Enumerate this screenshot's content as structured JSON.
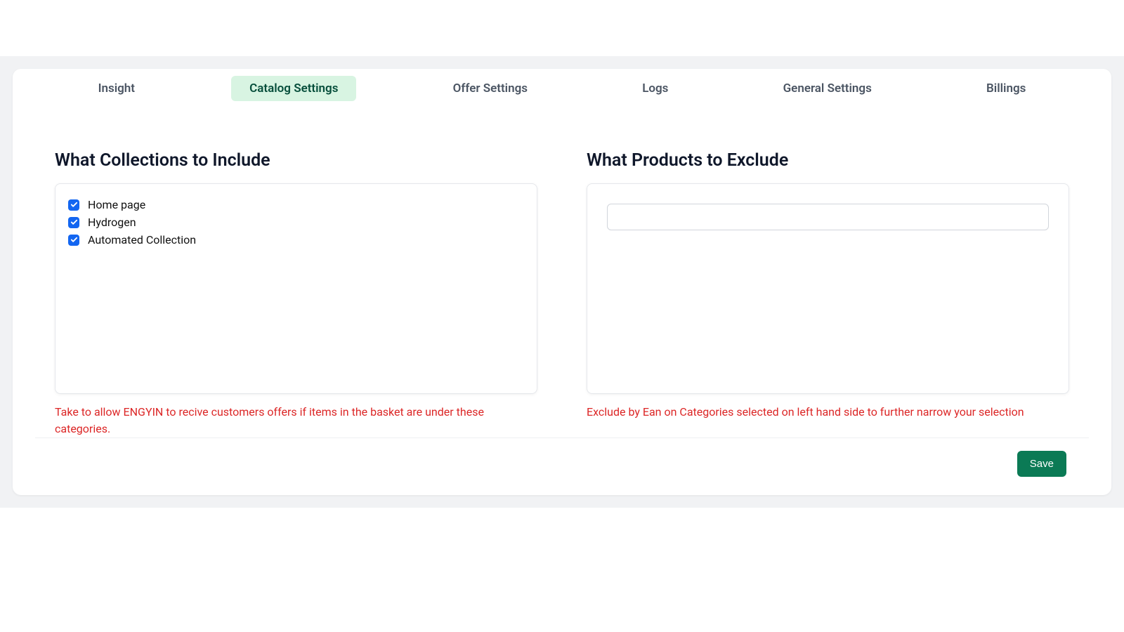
{
  "tabs": {
    "insight": "Insight",
    "catalog_settings": "Catalog Settings",
    "offer_settings": "Offer Settings",
    "logs": "Logs",
    "general_settings": "General Settings",
    "billings": "Billings"
  },
  "include": {
    "title": "What Collections to Include",
    "items": [
      {
        "label": "Home page",
        "checked": true
      },
      {
        "label": "Hydrogen",
        "checked": true
      },
      {
        "label": "Automated Collection",
        "checked": true
      }
    ],
    "helper": "Take to allow ENGYIN to recive customers offers if items in the basket are under these categories."
  },
  "exclude": {
    "title": "What Products to Exclude",
    "input_value": "",
    "helper": "Exclude by Ean on Categories selected on left hand side to further narrow your selection"
  },
  "actions": {
    "save": "Save"
  }
}
